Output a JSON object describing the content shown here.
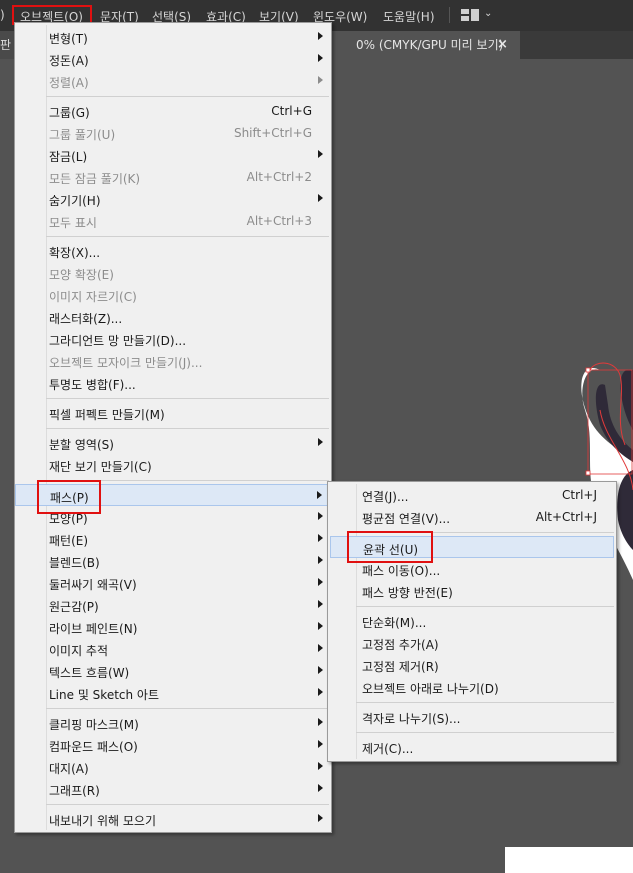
{
  "menubar": {
    "items": [
      "오브젝트(O)",
      "문자(T)",
      "선택(S)",
      "효과(C)",
      "보기(V)",
      "윈도우(W)",
      "도움말(H)"
    ],
    "prev_fragment": ")"
  },
  "tabs": {
    "left_fragment": "판",
    "doc_title": "0% (CMYK/GPU 미리 보기)",
    "close_glyph": "×"
  },
  "object_menu": [
    {
      "label": "변형(T)",
      "shortcut": "",
      "submenu": true,
      "disabled": false
    },
    {
      "label": "정돈(A)",
      "shortcut": "",
      "submenu": true,
      "disabled": false
    },
    {
      "label": "정렬(A)",
      "shortcut": "",
      "submenu": true,
      "disabled": true
    },
    {
      "label": "그룹(G)",
      "shortcut": "Ctrl+G",
      "submenu": false,
      "disabled": false
    },
    {
      "label": "그룹 풀기(U)",
      "shortcut": "Shift+Ctrl+G",
      "submenu": false,
      "disabled": true
    },
    {
      "label": "잠금(L)",
      "shortcut": "",
      "submenu": true,
      "disabled": false
    },
    {
      "label": "모든 잠금 풀기(K)",
      "shortcut": "Alt+Ctrl+2",
      "submenu": false,
      "disabled": true
    },
    {
      "label": "숨기기(H)",
      "shortcut": "",
      "submenu": true,
      "disabled": false
    },
    {
      "label": "모두 표시",
      "shortcut": "Alt+Ctrl+3",
      "submenu": false,
      "disabled": true
    },
    {
      "label": "확장(X)...",
      "shortcut": "",
      "submenu": false,
      "disabled": false
    },
    {
      "label": "모양 확장(E)",
      "shortcut": "",
      "submenu": false,
      "disabled": true
    },
    {
      "label": "이미지 자르기(C)",
      "shortcut": "",
      "submenu": false,
      "disabled": true
    },
    {
      "label": "래스터화(Z)...",
      "shortcut": "",
      "submenu": false,
      "disabled": false
    },
    {
      "label": "그라디언트 망 만들기(D)...",
      "shortcut": "",
      "submenu": false,
      "disabled": false
    },
    {
      "label": "오브젝트 모자이크 만들기(J)...",
      "shortcut": "",
      "submenu": false,
      "disabled": true
    },
    {
      "label": "투명도 병합(F)...",
      "shortcut": "",
      "submenu": false,
      "disabled": false
    },
    {
      "label": "픽셀 퍼펙트 만들기(M)",
      "shortcut": "",
      "submenu": false,
      "disabled": false
    },
    {
      "label": "분할 영역(S)",
      "shortcut": "",
      "submenu": true,
      "disabled": false
    },
    {
      "label": "재단 보기 만들기(C)",
      "shortcut": "",
      "submenu": false,
      "disabled": false
    },
    {
      "label": "패스(P)",
      "shortcut": "",
      "submenu": true,
      "disabled": false,
      "highlighted": true
    },
    {
      "label": "모양(P)",
      "shortcut": "",
      "submenu": true,
      "disabled": false
    },
    {
      "label": "패턴(E)",
      "shortcut": "",
      "submenu": true,
      "disabled": false
    },
    {
      "label": "블렌드(B)",
      "shortcut": "",
      "submenu": true,
      "disabled": false
    },
    {
      "label": "둘러싸기 왜곡(V)",
      "shortcut": "",
      "submenu": true,
      "disabled": false
    },
    {
      "label": "원근감(P)",
      "shortcut": "",
      "submenu": true,
      "disabled": false
    },
    {
      "label": "라이브 페인트(N)",
      "shortcut": "",
      "submenu": true,
      "disabled": false
    },
    {
      "label": "이미지 추적",
      "shortcut": "",
      "submenu": true,
      "disabled": false
    },
    {
      "label": "텍스트 흐름(W)",
      "shortcut": "",
      "submenu": true,
      "disabled": false
    },
    {
      "label": "Line 및 Sketch 아트",
      "shortcut": "",
      "submenu": true,
      "disabled": false
    },
    {
      "label": "클리핑 마스크(M)",
      "shortcut": "",
      "submenu": true,
      "disabled": false
    },
    {
      "label": "컴파운드 패스(O)",
      "shortcut": "",
      "submenu": true,
      "disabled": false
    },
    {
      "label": "대지(A)",
      "shortcut": "",
      "submenu": true,
      "disabled": false
    },
    {
      "label": "그래프(R)",
      "shortcut": "",
      "submenu": true,
      "disabled": false
    },
    {
      "label": "내보내기 위해 모으기",
      "shortcut": "",
      "submenu": true,
      "disabled": false
    }
  ],
  "path_submenu": [
    {
      "label": "연결(J)...",
      "shortcut": "Ctrl+J"
    },
    {
      "label": "평균점 연결(V)...",
      "shortcut": "Alt+Ctrl+J"
    },
    {
      "label": "윤곽 선(U)",
      "shortcut": "",
      "highlighted": true
    },
    {
      "label": "패스 이동(O)...",
      "shortcut": ""
    },
    {
      "label": "패스 방향 반전(E)",
      "shortcut": ""
    },
    {
      "label": "단순화(M)...",
      "shortcut": ""
    },
    {
      "label": "고정점 추가(A)",
      "shortcut": ""
    },
    {
      "label": "고정점 제거(R)",
      "shortcut": ""
    },
    {
      "label": "오브젝트 아래로 나누기(D)",
      "shortcut": ""
    },
    {
      "label": "격자로 나누기(S)...",
      "shortcut": ""
    },
    {
      "label": "제거(C)...",
      "shortcut": ""
    }
  ],
  "colors": {
    "highlight_box": "#e01010",
    "menu_bg": "#f0f0f0",
    "hover_bg": "#dde8f6"
  }
}
